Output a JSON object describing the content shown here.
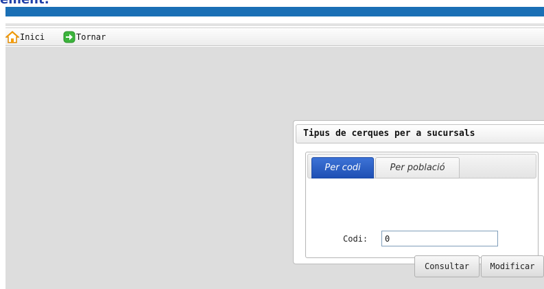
{
  "header": {
    "partial_title": "ement:"
  },
  "toolbar": {
    "home_label": "Inici",
    "home_icon": "home-icon",
    "back_label": "Tornar",
    "back_icon": "arrow-right-icon"
  },
  "dialog": {
    "title": "Tipus de cerques per a sucursals",
    "tabs": [
      {
        "label": "Per codi",
        "active": true
      },
      {
        "label": "Per població",
        "active": false
      }
    ],
    "codi_label": "Codi:",
    "codi_value": "0",
    "consultar_label": "Consultar",
    "modificar_label": "Modificar"
  },
  "colors": {
    "banner": "#1a6fb5",
    "active_tab": "#2a5ec4",
    "background": "#dddddd"
  }
}
